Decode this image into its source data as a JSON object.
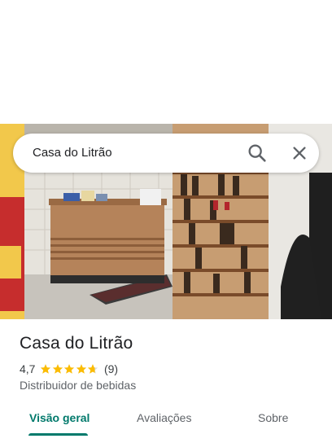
{
  "search": {
    "query": "Casa do Litrão",
    "search_icon": "search-icon",
    "close_icon": "close-icon"
  },
  "place": {
    "name": "Casa do Litrão",
    "rating": "4,7",
    "rating_stars": 4.7,
    "review_count": "(9)",
    "category": "Distribuidor de bebidas"
  },
  "tabs": [
    {
      "label": "Visão geral",
      "active": true
    },
    {
      "label": "Avaliações",
      "active": false
    },
    {
      "label": "Sobre",
      "active": false
    }
  ],
  "colors": {
    "accent": "#00796b",
    "star": "#fbbc04",
    "text": "#202124",
    "secondary_text": "#5f6368"
  }
}
